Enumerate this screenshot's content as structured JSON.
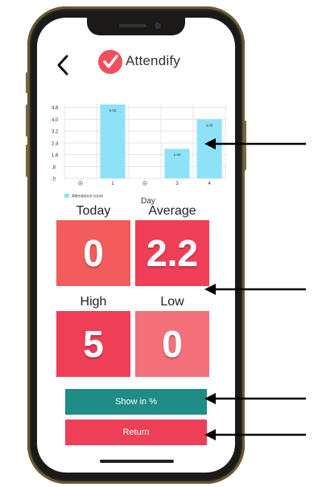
{
  "header": {
    "title": "Attendify"
  },
  "chart_data": {
    "type": "bar",
    "x_tick_labels": [
      "☹",
      "1",
      "☹",
      "3",
      "4"
    ],
    "values": [
      null,
      5.0,
      null,
      2.0,
      4.0
    ],
    "data_labels": [
      "",
      "5.00",
      "",
      "2.00",
      "4.00"
    ],
    "y_tick_labels": [
      ".0",
      ".8",
      "1.6",
      "2.4",
      "3.2",
      "4.0",
      "4.8"
    ],
    "y_ticks": [
      0,
      0.8,
      1.6,
      2.4,
      3.2,
      4.0,
      4.8
    ],
    "ylim": [
      0,
      5.0
    ],
    "xlabel": "Day",
    "legend": {
      "label": "Attendance count",
      "position": "bottom-left"
    },
    "grid": true,
    "colors": {
      "bar": "#8ee2f8",
      "grid": "#e4e4e4"
    }
  },
  "stats": {
    "today": {
      "label": "Today",
      "value": "0"
    },
    "average": {
      "label": "Average",
      "value": "2.2"
    },
    "high": {
      "label": "High",
      "value": "5"
    },
    "low": {
      "label": "Low",
      "value": "0"
    }
  },
  "actions": {
    "show_percent": "Show in %",
    "return": "Return"
  },
  "colors": {
    "today": "#f25c5c",
    "average": "#ee3f57",
    "high": "#ee3f57",
    "low": "#f4707a",
    "show_percent": "#1f8c86",
    "return": "#ee3f57",
    "logo": "#f0505c"
  }
}
